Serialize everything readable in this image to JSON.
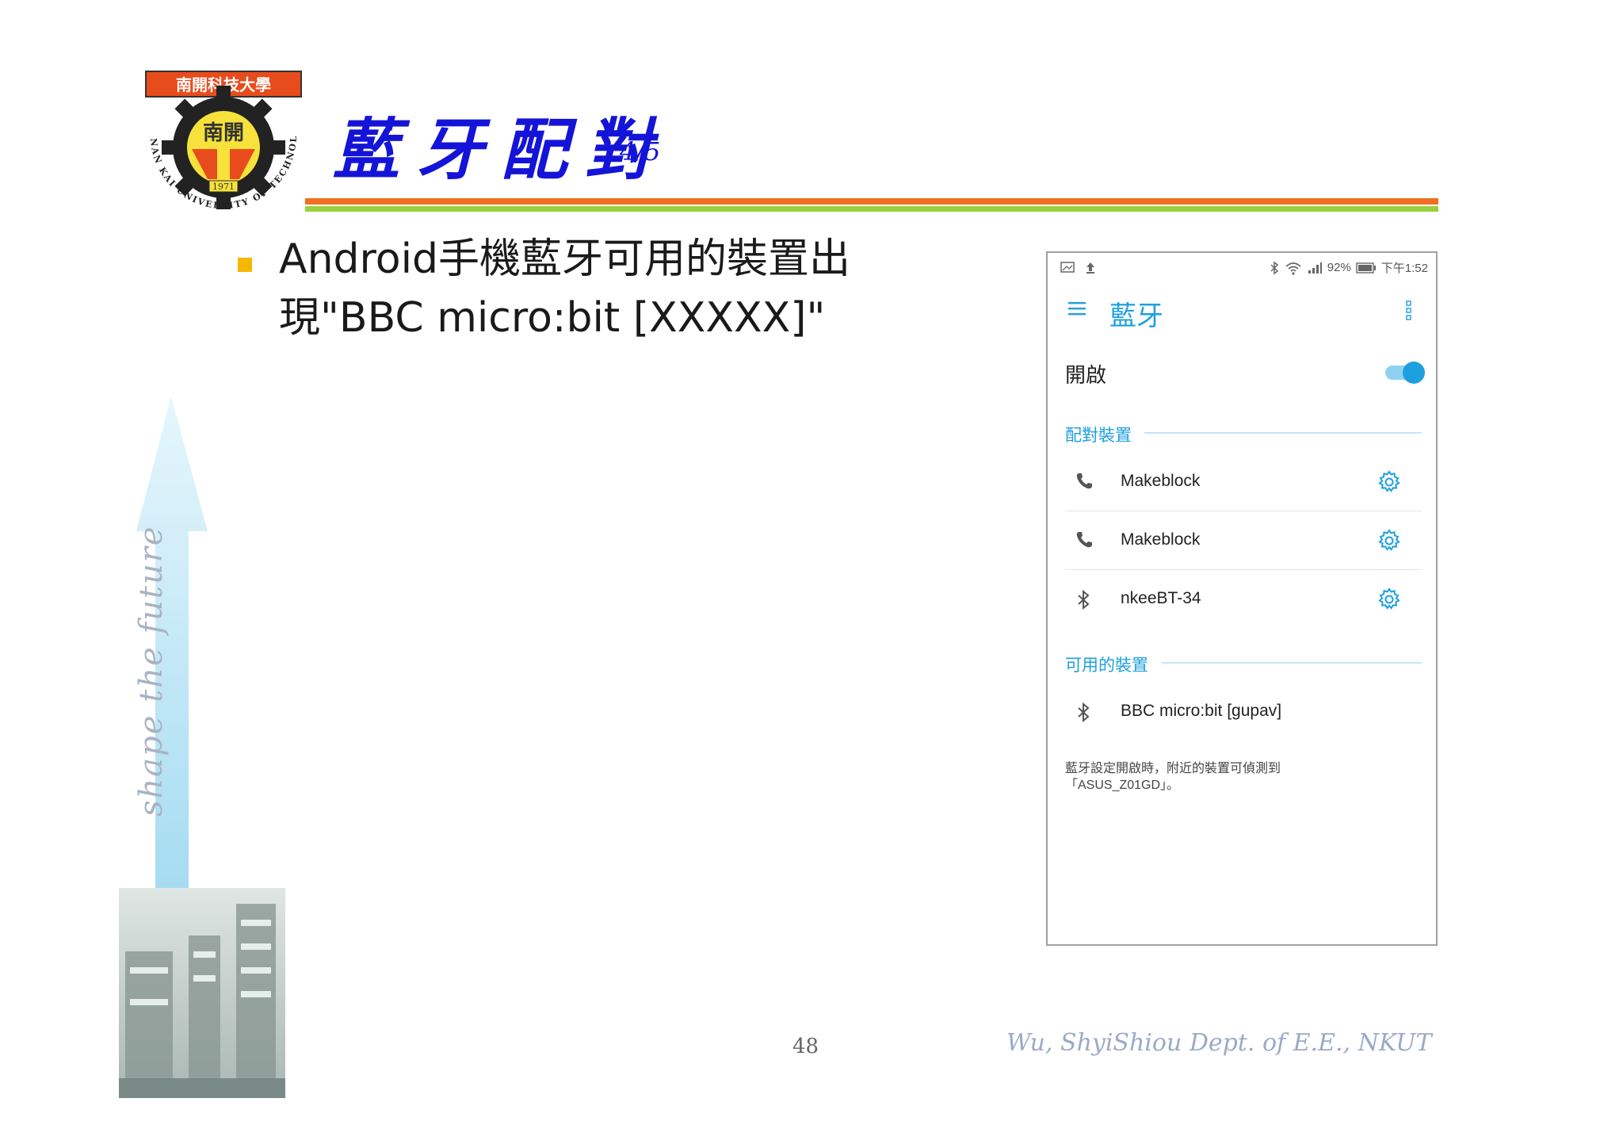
{
  "slide": {
    "logo_text": {
      "top": "南開科技大學",
      "center": "南開",
      "year": "1971",
      "ring": "NAN KAI UNIVERSITY OF TECHNOLOGY"
    },
    "title": "藍牙配對",
    "title_page": "4/5",
    "bullet": "Android手機藍牙可用的裝置出現\"BBC micro:bit [XXXXX]\"",
    "deco_text": "shape the future",
    "page_number": "48",
    "author": "Wu, ShyiShiou  Dept. of E.E., NKUT",
    "colors": {
      "title": "#1414d8",
      "rule_orange": "#f07020",
      "rule_green": "#98d040",
      "bullet": "#f5b800",
      "accent": "#1ea0e0"
    }
  },
  "phone": {
    "status_bar": {
      "battery": "92%",
      "time": "下午1:52"
    },
    "app_title": "藍牙",
    "toggle": {
      "label": "開啟",
      "state": "on"
    },
    "paired_header": "配對裝置",
    "paired": [
      {
        "name": "Makeblock",
        "icon": "phone-icon"
      },
      {
        "name": "Makeblock",
        "icon": "phone-icon"
      },
      {
        "name": "nkeeBT-34",
        "icon": "bluetooth-icon"
      }
    ],
    "available_header": "可用的裝置",
    "available": [
      {
        "name": "BBC micro:bit [gupav]",
        "icon": "bluetooth-icon"
      }
    ],
    "footer_line1": "藍牙設定開啟時，附近的裝置可偵測到",
    "footer_line2": "「ASUS_Z01GD」。"
  }
}
